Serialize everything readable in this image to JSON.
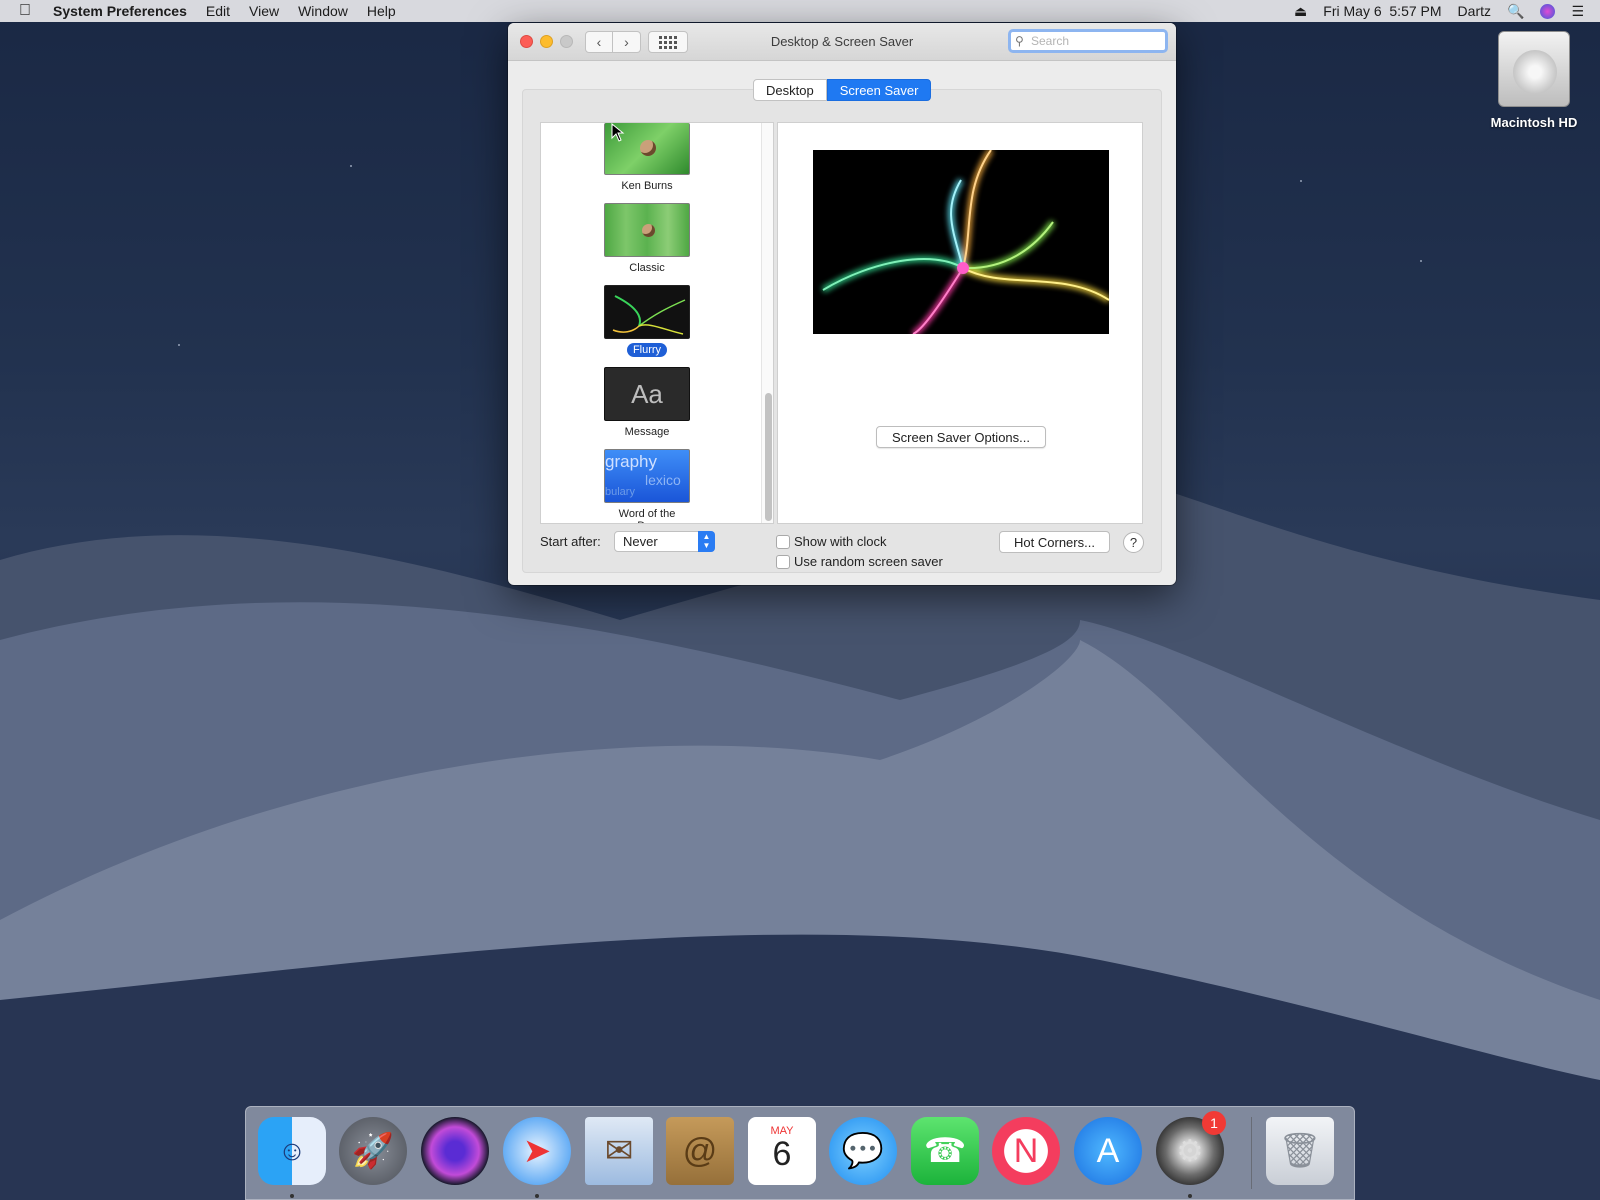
{
  "menubar": {
    "app_name": "System Preferences",
    "items": [
      "Edit",
      "View",
      "Window",
      "Help"
    ],
    "datetime": "Fri May 6  5:57 PM",
    "user": "Dartz"
  },
  "window": {
    "title": "Desktop & Screen Saver",
    "search_placeholder": "Search",
    "tabs": [
      "Desktop",
      "Screen Saver"
    ],
    "active_tab": "Screen Saver"
  },
  "screensavers": [
    {
      "label": "Ken Burns",
      "selected": false
    },
    {
      "label": "Classic",
      "selected": false
    },
    {
      "label": "Flurry",
      "selected": true
    },
    {
      "label": "Message",
      "selected": false,
      "thumb_text": "Aa"
    },
    {
      "label": "Word of the Day",
      "selected": false,
      "thumb_text": [
        "graphy",
        "lexico",
        "bulary"
      ]
    }
  ],
  "preview": {
    "options_button": "Screen Saver Options..."
  },
  "controls": {
    "start_after_label": "Start after:",
    "start_after_value": "Never",
    "show_with_clock": "Show with clock",
    "use_random": "Use random screen saver",
    "hot_corners": "Hot Corners...",
    "help": "?"
  },
  "desktop": {
    "drive_label": "Macintosh HD"
  },
  "dock": {
    "apps": [
      "Finder",
      "Launchpad",
      "Siri",
      "Safari",
      "Mail",
      "Contacts",
      "Calendar",
      "Messages",
      "FaceTime",
      "News",
      "App Store",
      "System Preferences",
      "Trash"
    ],
    "calendar_month": "MAY",
    "calendar_day": "6",
    "badge_count": "1"
  },
  "colors": {
    "accent": "#1f79f2",
    "selection": "#1f5fd6"
  }
}
